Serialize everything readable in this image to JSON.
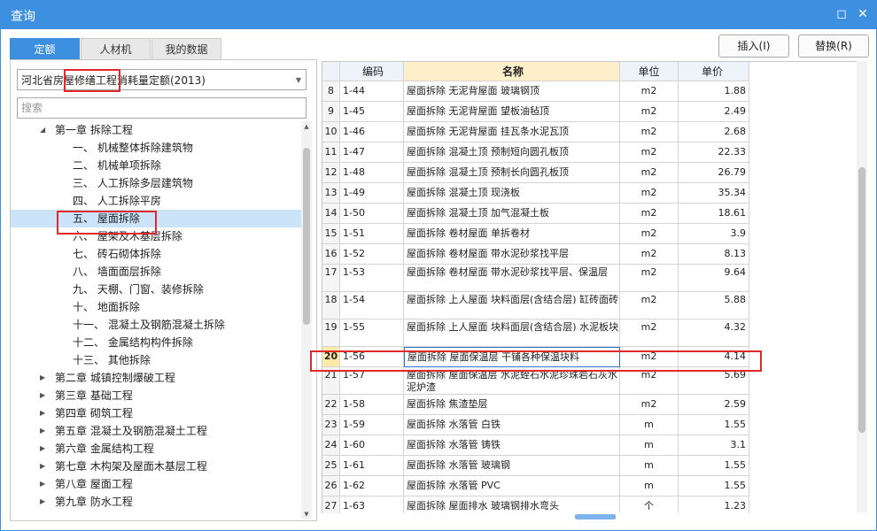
{
  "window": {
    "title": "查询",
    "restore_glyph": "◻",
    "close_glyph": "✕"
  },
  "tabs": [
    {
      "label": "定额"
    },
    {
      "label": "人材机"
    },
    {
      "label": "我的数据"
    }
  ],
  "actions": {
    "insert_label": "插入(I)",
    "replace_label": "替换(R)"
  },
  "library": {
    "selected": "河北省房屋修缮工程消耗量定额(2013)"
  },
  "search": {
    "placeholder": "搜索"
  },
  "tree": [
    {
      "label": "第一章 拆除工程",
      "expanded": true
    },
    {
      "label": "一、 机械整体拆除建筑物"
    },
    {
      "label": "二、 机械单项拆除"
    },
    {
      "label": "三、 人工拆除多层建筑物"
    },
    {
      "label": "四、 人工拆除平房"
    },
    {
      "label": "五、 屋面拆除",
      "selected": true
    },
    {
      "label": "六、 屋架及木基层拆除"
    },
    {
      "label": "七、 砖石砌体拆除"
    },
    {
      "label": "八、 墙面面层拆除"
    },
    {
      "label": "九、 天棚、门窗、装修拆除"
    },
    {
      "label": "十、 地面拆除"
    },
    {
      "label": "十一、 混凝土及钢筋混凝土拆除"
    },
    {
      "label": "十二、 金属结构构件拆除"
    },
    {
      "label": "十三、 其他拆除"
    },
    {
      "label": "第二章 城镇控制爆破工程"
    },
    {
      "label": "第三章 基础工程"
    },
    {
      "label": "第四章 砌筑工程"
    },
    {
      "label": "第五章 混凝土及钢筋混凝土工程"
    },
    {
      "label": "第六章 金属结构工程"
    },
    {
      "label": "第七章 木构架及屋面木基层工程"
    },
    {
      "label": "第八章 屋面工程"
    },
    {
      "label": "第九章 防水工程"
    }
  ],
  "table": {
    "headers": {
      "code": "编码",
      "name": "名称",
      "unit": "单位",
      "price": "单价"
    },
    "rows": [
      {
        "no": "8",
        "code": "1-44",
        "name": "屋面拆除 无泥背屋面 玻璃钢顶",
        "unit": "m2",
        "price": "1.88"
      },
      {
        "no": "9",
        "code": "1-45",
        "name": "屋面拆除 无泥背屋面 望板油毡顶",
        "unit": "m2",
        "price": "2.49"
      },
      {
        "no": "10",
        "code": "1-46",
        "name": "屋面拆除 无泥背屋面 挂瓦条水泥瓦顶",
        "unit": "m2",
        "price": "2.68"
      },
      {
        "no": "11",
        "code": "1-47",
        "name": "屋面拆除 混凝土顶 预制短向圆孔板顶",
        "unit": "m2",
        "price": "22.33"
      },
      {
        "no": "12",
        "code": "1-48",
        "name": "屋面拆除 混凝土顶 预制长向圆孔板顶",
        "unit": "m2",
        "price": "26.79"
      },
      {
        "no": "13",
        "code": "1-49",
        "name": "屋面拆除 混凝土顶 现浇板",
        "unit": "m2",
        "price": "35.34"
      },
      {
        "no": "14",
        "code": "1-50",
        "name": "屋面拆除 混凝土顶 加气混凝土板",
        "unit": "m2",
        "price": "18.61"
      },
      {
        "no": "15",
        "code": "1-51",
        "name": "屋面拆除 卷材屋面 单拆卷材",
        "unit": "m2",
        "price": "3.9"
      },
      {
        "no": "16",
        "code": "1-52",
        "name": "屋面拆除 卷材屋面 带水泥砂浆找平层",
        "unit": "m2",
        "price": "8.13"
      },
      {
        "no": "17",
        "code": "1-53",
        "name": "屋面拆除 卷材屋面 带水泥砂浆找平层、保温层",
        "unit": "m2",
        "price": "9.64",
        "tall": true
      },
      {
        "no": "18",
        "code": "1-54",
        "name": "屋面拆除 上人屋面 块料面层(含结合层) 缸砖面砖",
        "unit": "m2",
        "price": "5.88",
        "tall": true
      },
      {
        "no": "19",
        "code": "1-55",
        "name": "屋面拆除 上人屋面 块料面层(含结合层) 水泥板块",
        "unit": "m2",
        "price": "4.32",
        "tall": true
      },
      {
        "no": "20",
        "code": "1-56",
        "name": "屋面拆除 屋面保温层 干铺各种保温块料",
        "unit": "m2",
        "price": "4.14",
        "selected": true
      },
      {
        "no": "21",
        "code": "1-57",
        "name": "屋面拆除 屋面保温层 水泥蛭石水泥珍珠岩石灰水泥炉渣",
        "unit": "m2",
        "price": "5.69",
        "tall": true
      },
      {
        "no": "22",
        "code": "1-58",
        "name": "屋面拆除 焦渣垫层",
        "unit": "m2",
        "price": "2.59"
      },
      {
        "no": "23",
        "code": "1-59",
        "name": "屋面拆除 水落管 白铁",
        "unit": "m",
        "price": "1.55"
      },
      {
        "no": "24",
        "code": "1-60",
        "name": "屋面拆除 水落管 铸铁",
        "unit": "m",
        "price": "3.1"
      },
      {
        "no": "25",
        "code": "1-61",
        "name": "屋面拆除 水落管 玻璃钢",
        "unit": "m",
        "price": "1.55"
      },
      {
        "no": "26",
        "code": "1-62",
        "name": "屋面拆除 水落管 PVC",
        "unit": "m",
        "price": "1.55"
      },
      {
        "no": "27",
        "code": "1-63",
        "name": "屋面拆除 屋面排水 玻璃钢排水弯头",
        "unit": "个",
        "price": "1.23"
      }
    ]
  },
  "colors": {
    "accent": "#3d8fe0",
    "highlight": "#e02a2a",
    "selected_row": "#cce4fa"
  }
}
